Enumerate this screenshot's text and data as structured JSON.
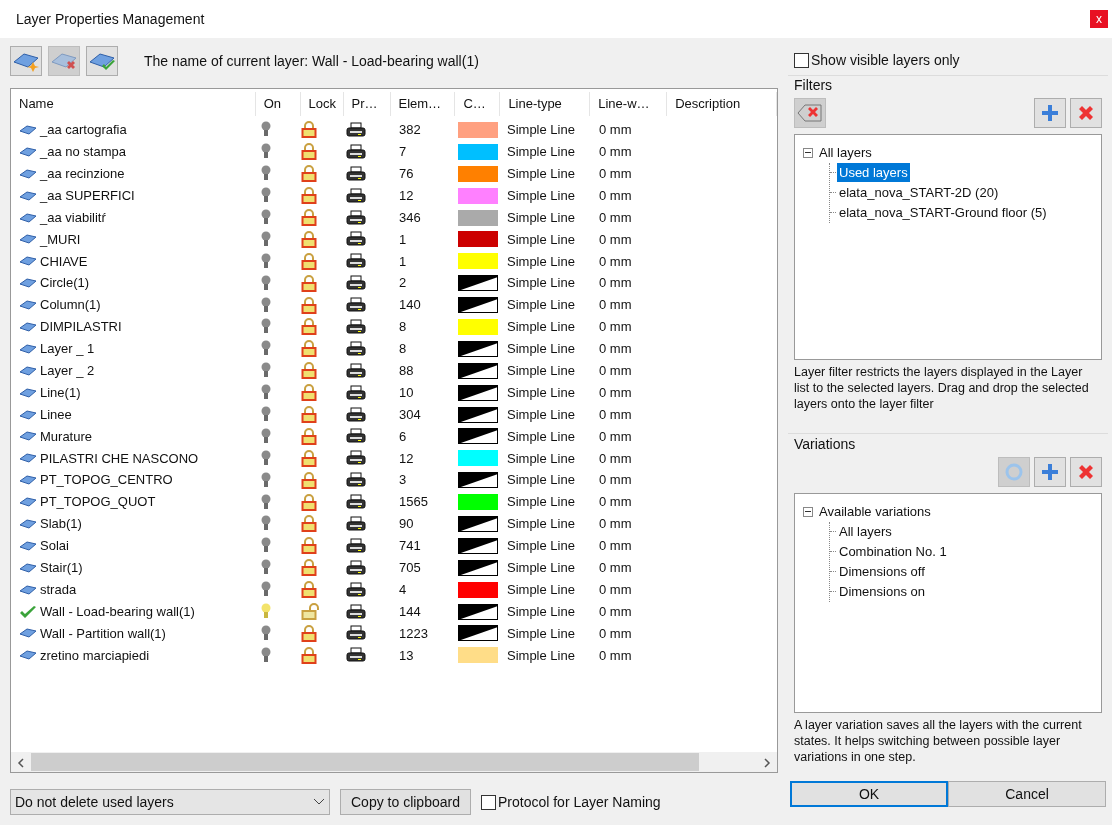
{
  "window": {
    "title": "Layer Properties Management",
    "close": "x"
  },
  "current_layer_label": "The name of current layer: Wall - Load-bearing wall(1)",
  "table": {
    "columns": [
      "Name",
      "On",
      "Lock",
      "Pr…",
      "Elem…",
      "C…",
      "Line-type",
      "Line-w…",
      "Description"
    ],
    "rows": [
      {
        "name": "_aa cartografia",
        "current": false,
        "on": false,
        "locked": true,
        "elements": "382",
        "kind": "solid",
        "color": "#ffa080",
        "line_type": "Simple Line",
        "line_width": "0 mm"
      },
      {
        "name": "_aa no stampa",
        "current": false,
        "on": false,
        "locked": true,
        "elements": "7",
        "kind": "solid",
        "color": "#00bfff",
        "line_type": "Simple Line",
        "line_width": "0 mm"
      },
      {
        "name": "_aa recinzione",
        "current": false,
        "on": false,
        "locked": true,
        "elements": "76",
        "kind": "solid",
        "color": "#ff8000",
        "line_type": "Simple Line",
        "line_width": "0 mm"
      },
      {
        "name": "_aa SUPERFICI",
        "current": false,
        "on": false,
        "locked": true,
        "elements": "12",
        "kind": "solid",
        "color": "#ff80ff",
        "line_type": "Simple Line",
        "line_width": "0 mm"
      },
      {
        "name": "_aa viabilitŕ",
        "current": false,
        "on": false,
        "locked": true,
        "elements": "346",
        "kind": "solid",
        "color": "#aaaaaa",
        "line_type": "Simple Line",
        "line_width": "0 mm"
      },
      {
        "name": "_MURI",
        "current": false,
        "on": false,
        "locked": true,
        "elements": "1",
        "kind": "solid",
        "color": "#cc0000",
        "line_type": "Simple Line",
        "line_width": "0 mm"
      },
      {
        "name": "CHIAVE",
        "current": false,
        "on": false,
        "locked": true,
        "elements": "1",
        "kind": "solid",
        "color": "#ffff00",
        "line_type": "Simple Line",
        "line_width": "0 mm"
      },
      {
        "name": "Circle(1)",
        "current": false,
        "on": false,
        "locked": true,
        "elements": "2",
        "kind": "auto",
        "line_type": "Simple Line",
        "line_width": "0 mm"
      },
      {
        "name": "Column(1)",
        "current": false,
        "on": false,
        "locked": true,
        "elements": "140",
        "kind": "auto",
        "line_type": "Simple Line",
        "line_width": "0 mm"
      },
      {
        "name": "DIMPILASTRI",
        "current": false,
        "on": false,
        "locked": true,
        "elements": "8",
        "kind": "solid",
        "color": "#ffff00",
        "line_type": "Simple Line",
        "line_width": "0 mm"
      },
      {
        "name": "Layer _ 1",
        "current": false,
        "on": false,
        "locked": true,
        "elements": "8",
        "kind": "auto",
        "line_type": "Simple Line",
        "line_width": "0 mm"
      },
      {
        "name": "Layer _ 2",
        "current": false,
        "on": false,
        "locked": true,
        "elements": "88",
        "kind": "auto",
        "line_type": "Simple Line",
        "line_width": "0 mm"
      },
      {
        "name": "Line(1)",
        "current": false,
        "on": false,
        "locked": true,
        "elements": "10",
        "kind": "auto",
        "line_type": "Simple Line",
        "line_width": "0 mm"
      },
      {
        "name": "Linee",
        "current": false,
        "on": false,
        "locked": true,
        "elements": "304",
        "kind": "auto",
        "line_type": "Simple Line",
        "line_width": "0 mm"
      },
      {
        "name": "Murature",
        "current": false,
        "on": false,
        "locked": true,
        "elements": "6",
        "kind": "auto",
        "line_type": "Simple Line",
        "line_width": "0 mm"
      },
      {
        "name": "PILASTRI CHE NASCONO",
        "current": false,
        "on": false,
        "locked": true,
        "elements": "12",
        "kind": "solid",
        "color": "#00ffff",
        "line_type": "Simple Line",
        "line_width": "0 mm"
      },
      {
        "name": "PT_TOPOG_CENTRO",
        "current": false,
        "on": false,
        "locked": true,
        "elements": "3",
        "kind": "auto",
        "line_type": "Simple Line",
        "line_width": "0 mm"
      },
      {
        "name": "PT_TOPOG_QUOT",
        "current": false,
        "on": false,
        "locked": true,
        "elements": "1565",
        "kind": "solid",
        "color": "#00ff00",
        "line_type": "Simple Line",
        "line_width": "0 mm"
      },
      {
        "name": "Slab(1)",
        "current": false,
        "on": false,
        "locked": true,
        "elements": "90",
        "kind": "auto",
        "line_type": "Simple Line",
        "line_width": "0 mm"
      },
      {
        "name": "Solai",
        "current": false,
        "on": false,
        "locked": true,
        "elements": "741",
        "kind": "auto",
        "line_type": "Simple Line",
        "line_width": "0 mm"
      },
      {
        "name": "Stair(1)",
        "current": false,
        "on": false,
        "locked": true,
        "elements": "705",
        "kind": "auto",
        "line_type": "Simple Line",
        "line_width": "0 mm"
      },
      {
        "name": "strada",
        "current": false,
        "on": false,
        "locked": true,
        "elements": "4",
        "kind": "solid",
        "color": "#ff0000",
        "line_type": "Simple Line",
        "line_width": "0 mm"
      },
      {
        "name": "Wall - Load-bearing wall(1)",
        "current": true,
        "on": true,
        "locked": false,
        "elements": "144",
        "kind": "auto",
        "line_type": "Simple Line",
        "line_width": "0 mm"
      },
      {
        "name": "Wall - Partition wall(1)",
        "current": false,
        "on": false,
        "locked": true,
        "elements": "1223",
        "kind": "auto",
        "line_type": "Simple Line",
        "line_width": "0 mm"
      },
      {
        "name": "zretino marciapiedi",
        "current": false,
        "on": false,
        "locked": true,
        "elements": "13",
        "kind": "solid",
        "color": "#ffdd88",
        "line_type": "Simple Line",
        "line_width": "0 mm"
      }
    ]
  },
  "delete_mode": {
    "value": "Do not delete used layers"
  },
  "copy_button": "Copy to clipboard",
  "protocol_checkbox": {
    "label": "Protocol for Layer Naming",
    "checked": false
  },
  "show_visible_only": {
    "label": "Show visible layers only",
    "checked": false
  },
  "filters": {
    "title": "Filters",
    "tree": {
      "label": "All layers",
      "expanded": true,
      "selected": false,
      "children": [
        {
          "label": "Used layers",
          "selected": true
        },
        {
          "label": "elata_nova_START-2D (20)",
          "selected": false
        },
        {
          "label": "elata_nova_START-Ground floor (5)",
          "selected": false
        }
      ]
    },
    "help": "Layer filter restricts the layers displayed in the Layer list to the selected layers. Drag and drop the selected layers onto the layer filter"
  },
  "variations": {
    "title": "Variations",
    "tree": {
      "label": "Available variations",
      "expanded": true,
      "selected": false,
      "children": [
        {
          "label": "All layers",
          "selected": false
        },
        {
          "label": "Combination No. 1",
          "selected": false
        },
        {
          "label": "Dimensions off",
          "selected": false
        },
        {
          "label": "Dimensions on",
          "selected": false
        }
      ]
    },
    "help": "A layer variation saves all the layers with the current states. It helps switching between possible layer variations in one step."
  },
  "buttons": [
    "OK",
    "Cancel"
  ]
}
